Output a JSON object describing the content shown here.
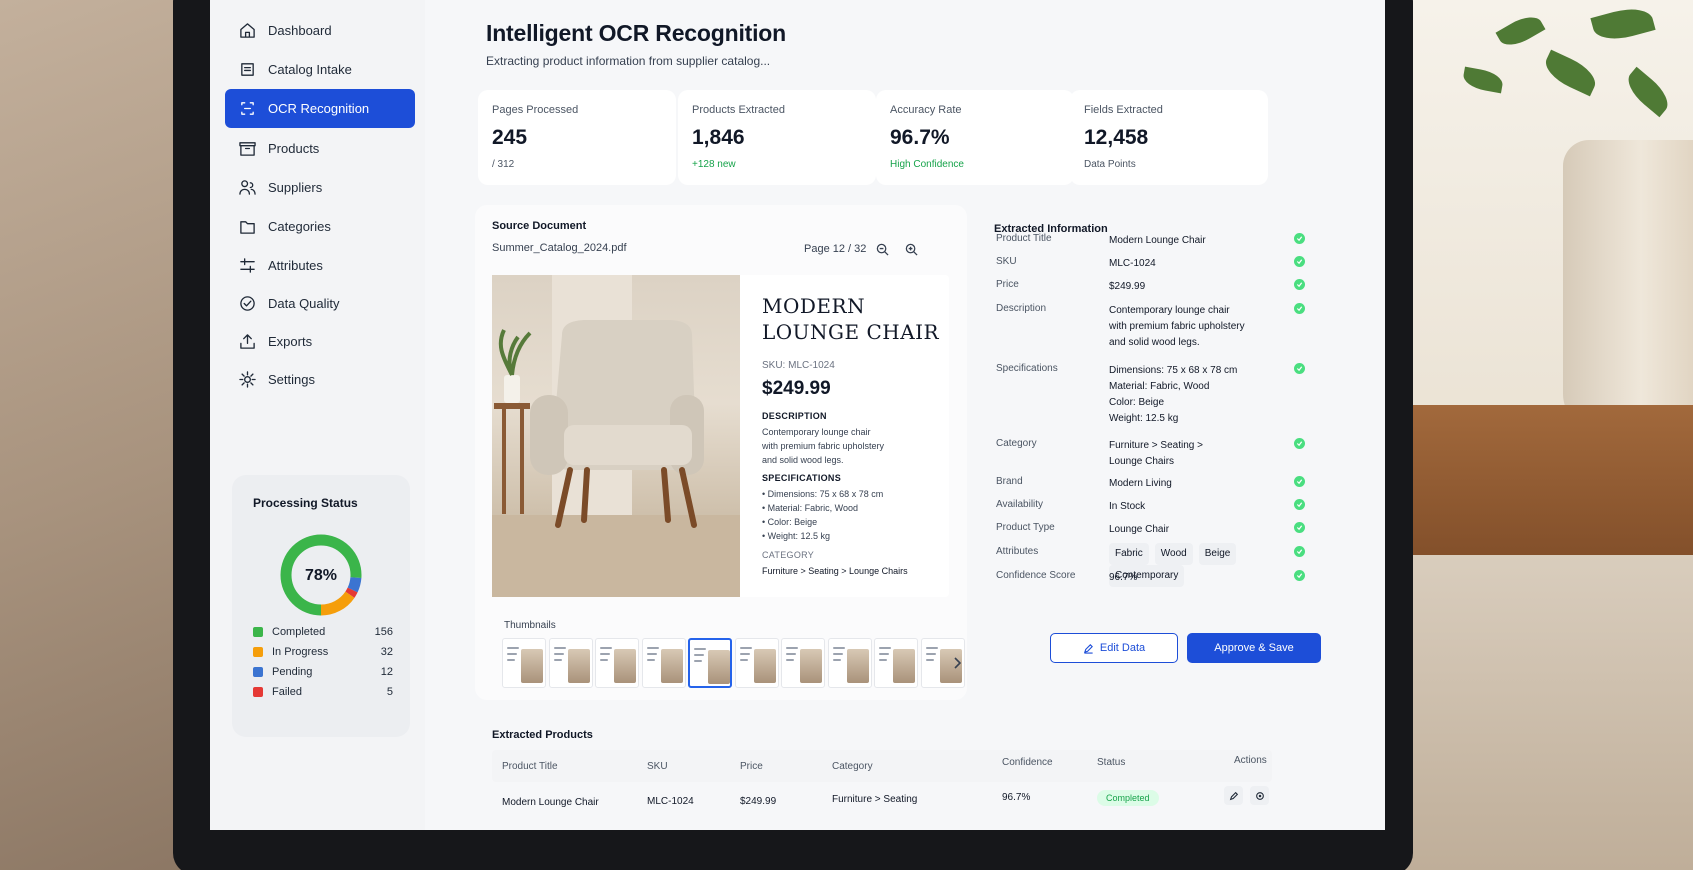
{
  "sidebar": {
    "items": [
      {
        "label": "Dashboard",
        "icon": "home-icon"
      },
      {
        "label": "Catalog Intake",
        "icon": "intake-icon"
      },
      {
        "label": "OCR Recognition",
        "icon": "scan-icon",
        "active": true
      },
      {
        "label": "Products",
        "icon": "box-icon"
      },
      {
        "label": "Suppliers",
        "icon": "users-icon"
      },
      {
        "label": "Categories",
        "icon": "folder-icon"
      },
      {
        "label": "Attributes",
        "icon": "sliders-icon"
      },
      {
        "label": "Data Quality",
        "icon": "check-circle-icon"
      },
      {
        "label": "Exports",
        "icon": "export-icon"
      },
      {
        "label": "Settings",
        "icon": "gear-icon"
      }
    ],
    "status": {
      "title": "Processing Status",
      "percent_label": "78%",
      "legend": [
        {
          "label": "Completed",
          "count": "156",
          "color": "#3bb54a"
        },
        {
          "label": "In Progress",
          "count": "32",
          "color": "#f59e0b"
        },
        {
          "label": "Pending",
          "count": "12",
          "color": "#3b74d1"
        },
        {
          "label": "Failed",
          "count": "5",
          "color": "#e53935"
        }
      ]
    }
  },
  "header": {
    "title": "Intelligent OCR Recognition",
    "subtitle": "Extracting product information from supplier catalog..."
  },
  "stats": [
    {
      "label": "Pages Processed",
      "value": "245",
      "note": "/ 312",
      "note_color": "#4b5563"
    },
    {
      "label": "Products Extracted",
      "value": "1,846",
      "note": "+128 new",
      "note_color": "#16a34a"
    },
    {
      "label": "Accuracy Rate",
      "value": "96.7%",
      "note": "High Confidence",
      "note_color": "#16a34a"
    },
    {
      "label": "Fields Extracted",
      "value": "12,458",
      "note": "Data Points",
      "note_color": "#4b5563"
    }
  ],
  "source": {
    "title": "Source Document",
    "filename": "Summer_Catalog_2024.pdf",
    "page_label": "Page 12 / 32",
    "doc": {
      "title_line1": "MODERN",
      "title_line2": "LOUNGE CHAIR",
      "sku": "SKU: MLC-1024",
      "price": "$249.99",
      "desc_head": "DESCRIPTION",
      "desc_lines": [
        "Contemporary lounge chair",
        "with premium fabric upholstery",
        "and solid wood legs."
      ],
      "spec_head": "SPECIFICATIONS",
      "spec_lines": [
        "• Dimensions: 75 x 68 x 78 cm",
        "• Material: Fabric, Wood",
        "• Color: Beige",
        "• Weight: 12.5 kg"
      ],
      "cat_head": "CATEGORY",
      "cat_value": "Furniture > Seating > Lounge Chairs"
    },
    "thumbnails_label": "Thumbnails",
    "thumbnail_count": 10,
    "selected_thumbnail": 4
  },
  "extracted": {
    "title": "Extracted Information",
    "fields": [
      {
        "key": "Product Title",
        "lines": [
          "Modern Lounge Chair"
        ]
      },
      {
        "key": "SKU",
        "lines": [
          "MLC-1024"
        ]
      },
      {
        "key": "Price",
        "lines": [
          "$249.99"
        ]
      },
      {
        "key": "Description",
        "lines": [
          "Contemporary lounge chair",
          "with premium fabric upholstery",
          "and solid wood legs."
        ]
      },
      {
        "key": "Specifications",
        "lines": [
          "Dimensions: 75 x 68 x 78 cm",
          "Material: Fabric, Wood",
          "Color: Beige",
          "Weight: 12.5 kg"
        ]
      },
      {
        "key": "Category",
        "lines": [
          "Furniture > Seating >",
          "Lounge Chairs"
        ]
      },
      {
        "key": "Brand",
        "lines": [
          "Modern Living"
        ]
      },
      {
        "key": "Availability",
        "lines": [
          "In Stock"
        ]
      },
      {
        "key": "Product Type",
        "lines": [
          "Lounge Chair"
        ]
      },
      {
        "key": "Attributes",
        "chips": [
          "Fabric",
          "Wood",
          "Beige",
          "Contemporary"
        ]
      },
      {
        "key": "Confidence Score",
        "lines": [
          "96.7%"
        ]
      }
    ],
    "edit_label": "Edit Data",
    "save_label": "Approve & Save"
  },
  "products": {
    "title": "Extracted Products",
    "columns": [
      "Product Title",
      "SKU",
      "Price",
      "Category",
      "Confidence",
      "Status",
      "Actions"
    ],
    "rows": [
      {
        "title": "Modern Lounge Chair",
        "sku": "MLC-1024",
        "price": "$249.99",
        "category": "Furniture > Seating",
        "confidence": "96.7%",
        "status": "Completed"
      }
    ]
  }
}
